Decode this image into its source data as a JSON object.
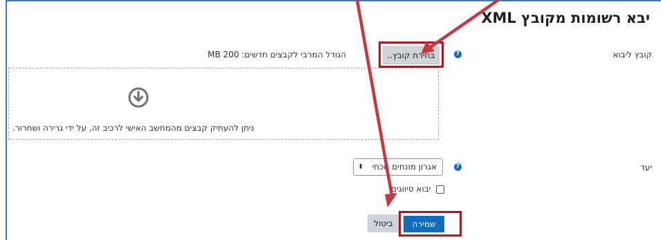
{
  "page": {
    "title": "יבא רשומות מקובץ XML"
  },
  "form": {
    "import_file_label": "קובץ ליבוא",
    "choose_file_button": "בחירת קובץ..",
    "max_size_text": "הגודל המרבי לקבצים חדשים: 200 MB",
    "drop_text": "ניתן להעתיק קבצים מהמחשב האישי לרכיב זה, על ידי גרירה ושחרור.",
    "destination_label": "יעד",
    "destination_value": "אגרון מונחים נוכחי",
    "import_categories_label": "יבוא סיווגים",
    "help_icon_glyph": "?",
    "select_arrow_glyph": "⬍"
  },
  "buttons": {
    "save": "שמירה",
    "cancel": "ביטול"
  },
  "colors": {
    "accent": "#0f6cbf",
    "annotation": "#b3141b",
    "border": "#3d79c2"
  }
}
